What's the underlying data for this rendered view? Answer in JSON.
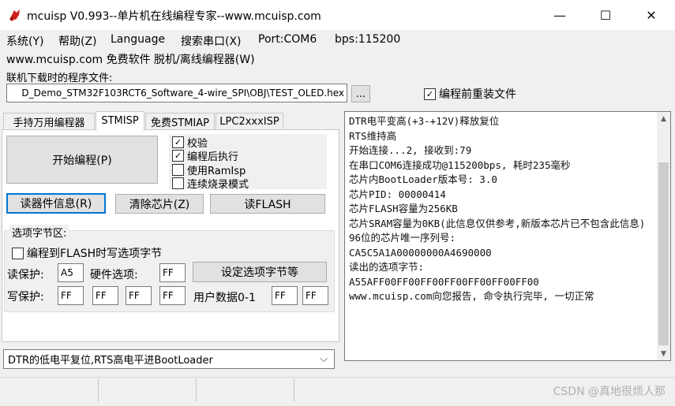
{
  "window": {
    "title": "mcuisp V0.993--单片机在线编程专家--www.mcuisp.com",
    "controls": {
      "minimize": "—",
      "maximize": "☐",
      "close": "✕"
    }
  },
  "menu": [
    "系统(Y)",
    "帮助(Z)",
    "Language",
    "搜索串口(X)",
    "Port:COM6",
    "bps:115200"
  ],
  "link_line": "www.mcuisp.com 免费软件 脱机/离线编程器(W)",
  "file_section": {
    "label": "联机下载时的程序文件:",
    "path": "D_Demo_STM32F103RCT6_Software_4-wire_SPI\\OBJ\\TEST_OLED.hex",
    "browse_label": "...",
    "reload_checkbox": {
      "label": "编程前重装文件",
      "checked": true
    }
  },
  "tabs": [
    {
      "label": "手持万用编程器",
      "active": false
    },
    {
      "label": "STMISP",
      "active": true
    },
    {
      "label": "免费STMIAP",
      "active": false
    },
    {
      "label": "LPC2xxxISP",
      "active": false
    }
  ],
  "panel": {
    "start_button": "开始编程(P)",
    "options": [
      {
        "label": "校验",
        "checked": true
      },
      {
        "label": "编程后执行",
        "checked": true
      },
      {
        "label": "使用RamIsp",
        "checked": false
      },
      {
        "label": "连续烧录模式",
        "checked": false
      }
    ],
    "read_info_button": "读器件信息(R)",
    "erase_button": "清除芯片(Z)",
    "read_flash_button": "读FLASH",
    "option_bytes": {
      "group_label": "选项字节区:",
      "write_checkbox": {
        "label": "编程到FLASH时写选项字节",
        "checked": false
      },
      "read_protect_label": "读保护:",
      "read_protect_value": "A5",
      "hw_option_label": "硬件选项:",
      "hw_option_value": "FF",
      "set_button": "设定选项字节等",
      "write_protect_label": "写保护:",
      "write_protect_values": [
        "FF",
        "FF",
        "FF",
        "FF"
      ],
      "user_data_label": "用户数据0-1",
      "user_data_values": [
        "FF",
        "FF"
      ]
    }
  },
  "boot_select": {
    "value": "DTR的低电平复位,RTS高电平进BootLoader",
    "arrow": "⌵"
  },
  "log": [
    "DTR电平变高(+3-+12V)释放复位",
    "RTS维持高",
    "开始连接...2, 接收到:79",
    "在串口COM6连接成功@115200bps, 耗时235毫秒",
    "芯片内BootLoader版本号: 3.0",
    "芯片PID: 00000414",
    "芯片FLASH容量为256KB",
    "芯片SRAM容量为0KB(此信息仅供参考,新版本芯片已不包含此信息)",
    "96位的芯片唯一序列号:",
    "CA5C5A1A00000000A4690000",
    "读出的选项字节:",
    "A55AFF00FF00FF00FF00FF00FF00FF00",
    "www.mcuisp.com向您报告, 命令执行完毕, 一切正常"
  ],
  "scrollbar": {
    "up": "▲",
    "down": "▼"
  },
  "watermark": "CSDN @真地很烦人那",
  "colors": {
    "logo": "#d0201c",
    "active_tab": "#ffffff",
    "button": "#e1e1e1"
  }
}
